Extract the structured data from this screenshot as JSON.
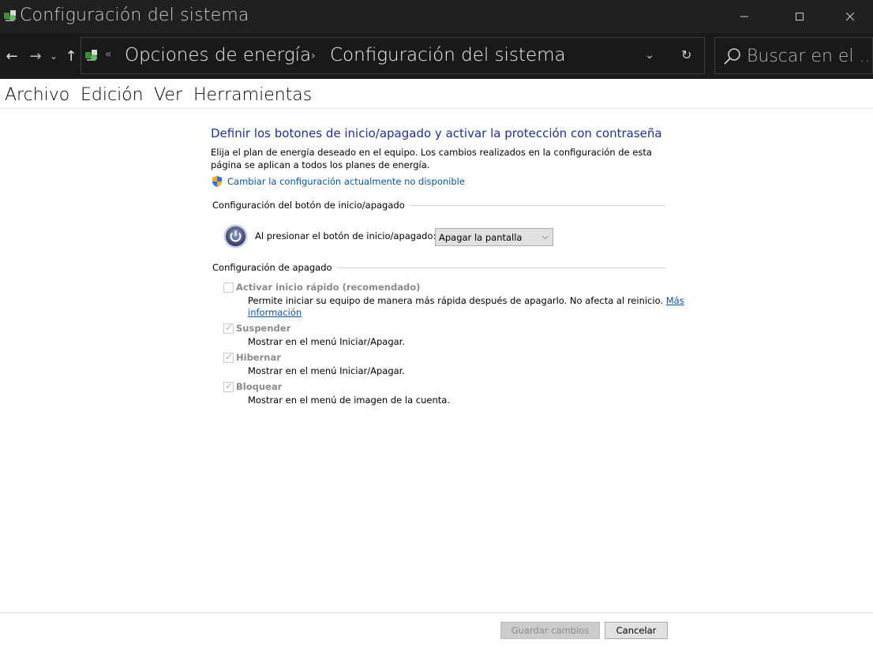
{
  "window": {
    "title": "Configuración del sistema",
    "minimize_icon": "minimize-icon",
    "maximize_icon": "maximize-icon",
    "close_icon": "close-icon"
  },
  "nav": {
    "back": "←",
    "forward": "→",
    "recent": "⌄",
    "up": "↑"
  },
  "address": {
    "overflow": "«",
    "crumbs": [
      "Opciones de energía",
      "Configuración del sistema"
    ],
    "separator": "›"
  },
  "search": {
    "placeholder": "Buscar en el ..."
  },
  "menu": [
    "Archivo",
    "Edición",
    "Ver",
    "Herramientas"
  ],
  "content": {
    "heading": "Definir los botones de inicio/apagado y activar la protección con contraseña",
    "description": "Elija el plan de energía deseado en el equipo. Los cambios realizados en la configuración de esta página se aplican a todos los planes de energía.",
    "admin_link": "Cambiar la configuración actualmente no disponible",
    "power_section": {
      "title": "Configuración del botón de inicio/apagado",
      "label": "Al presionar el botón de inicio/apagado:",
      "selected": "Apagar la pantalla"
    },
    "shutdown_section": {
      "title": "Configuración de apagado",
      "options": [
        {
          "label": "Activar inicio rápido (recomendado)",
          "checked": false,
          "desc_line1": "Permite iniciar su equipo de manera más rápida después de apagarlo. No afecta al reinicio.",
          "link_part1": "Más",
          "link_part2": "información"
        },
        {
          "label": "Suspender",
          "checked": true,
          "desc": "Mostrar en el menú Iniciar/Apagar."
        },
        {
          "label": "Hibernar",
          "checked": true,
          "desc": "Mostrar en el menú Iniciar/Apagar."
        },
        {
          "label": "Bloquear",
          "checked": true,
          "desc": "Mostrar en el menú de imagen de la cuenta."
        }
      ]
    }
  },
  "footer": {
    "save": "Guardar cambios",
    "cancel": "Cancelar"
  },
  "colors": {
    "titlebar_bg": "#202020",
    "heading": "#1e3287",
    "link": "#0b5394"
  }
}
